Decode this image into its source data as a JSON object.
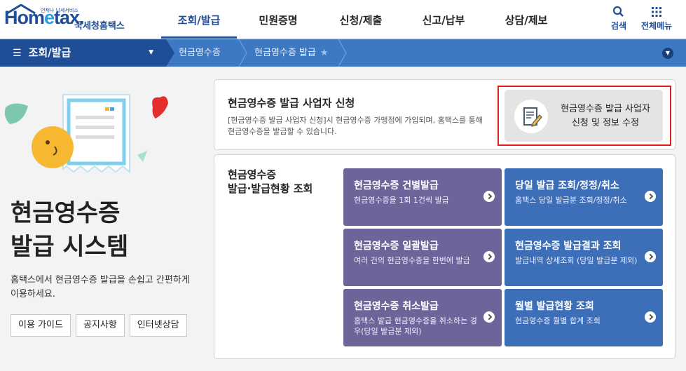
{
  "header": {
    "logo_small": "언제나 납세서비스",
    "logo_main_1": "Hom",
    "logo_main_e": "e",
    "logo_main_2": "tax.",
    "logo_kr": "국세청홈택스",
    "nav": [
      {
        "label": "조회/발급",
        "active": true
      },
      {
        "label": "민원증명",
        "active": false
      },
      {
        "label": "신청/제출",
        "active": false
      },
      {
        "label": "신고/납부",
        "active": false
      },
      {
        "label": "상담/제보",
        "active": false
      }
    ],
    "search_label": "검색",
    "allmenu_label": "전체메뉴"
  },
  "breadcrumb": {
    "menu_label": "조회/발급",
    "items": [
      "현금영수증",
      "현금영수증 발급"
    ]
  },
  "intro": {
    "title_line1": "현금영수증",
    "title_line2": "발급 시스템",
    "desc": "홈택스에서 현금영수증 발급을 손쉽고 간편하게 이용하세요.",
    "buttons": [
      "이용 가이드",
      "공지사항",
      "인터넷상담"
    ]
  },
  "apply": {
    "title": "현금영수증 발급 사업자 신청",
    "desc": "[현금영수증 발급 사업자 신청]시 현금영수증 가맹점에 가입되며, 홈택스를 통해 현금영수증을 발급할 수 있습니다.",
    "button_line1": "현금영수증 발급 사업자",
    "button_line2": "신청 및 정보 수정"
  },
  "inquiry": {
    "title_line1": "현금영수증",
    "title_line2": "발급·발급현황 조회",
    "tiles": [
      {
        "title": "현금영수증 건별발급",
        "sub": "현금영수증을 1회 1건씩 발급"
      },
      {
        "title": "당일 발급 조회/정정/취소",
        "sub": "홈택스 당일 발급분 조회/정정/취소"
      },
      {
        "title": "현금영수증 일괄발급",
        "sub": "여러 건의 현금영수증을 한번에 발급"
      },
      {
        "title": "현금영수증 발급결과 조회",
        "sub": "발급내역 상세조회 (당일 발급분 제외)"
      },
      {
        "title": "현금영수증 취소발급",
        "sub": "홈택스 발급 현금영수증을 취소하는 경우(당일 발급분 제외)"
      },
      {
        "title": "월별 발급현황 조회",
        "sub": "현금영수증 월별 합계 조회"
      }
    ]
  },
  "colors": {
    "brand": "#1f4e96",
    "crumb_bar": "#3d78c3",
    "tile_purple": "#6d6599",
    "tile_blue": "#3d6fb8",
    "highlight": "#e21b1b"
  }
}
